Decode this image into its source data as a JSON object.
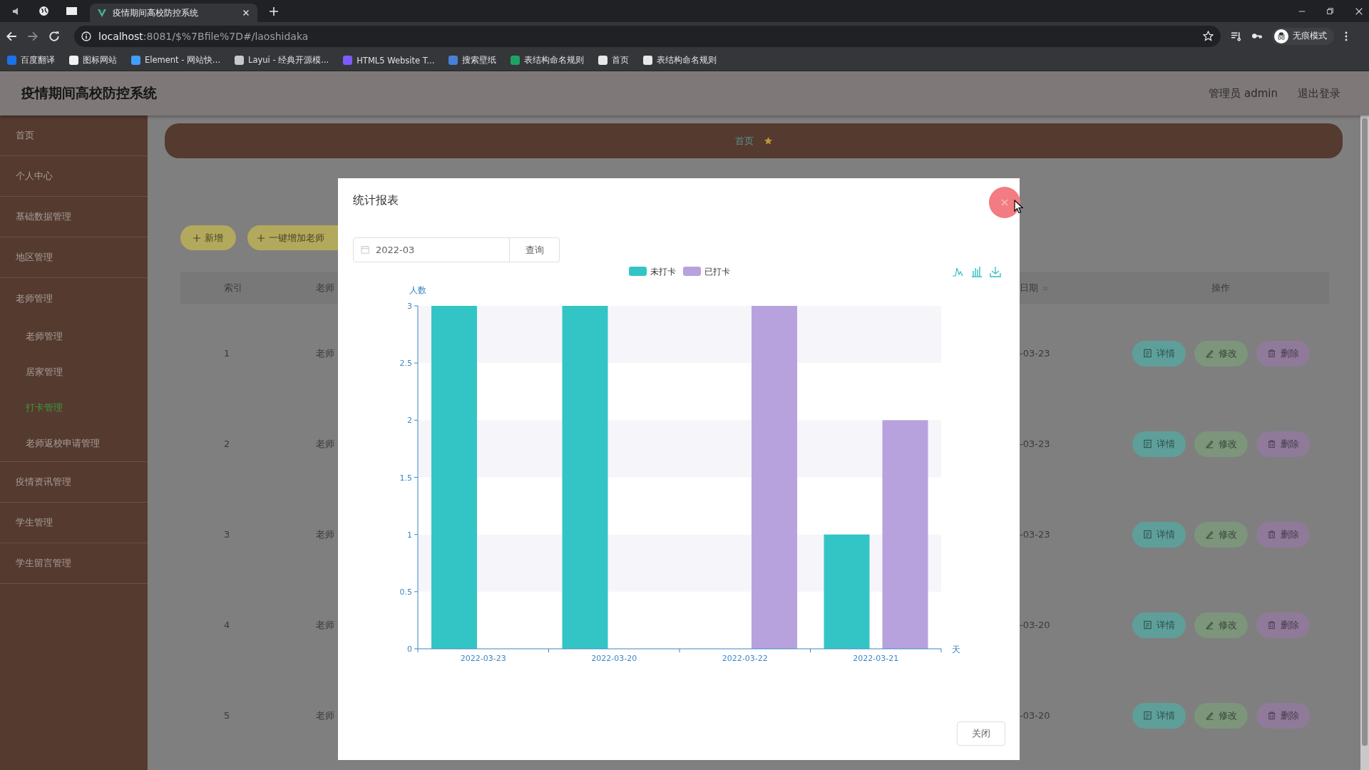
{
  "browser": {
    "tab": {
      "title": "疫情期间高校防控系统"
    },
    "address": {
      "host": "localhost",
      "path": ":8081/$%7Bfile%7D#/laoshidaka"
    },
    "profile": {
      "label": "无痕模式"
    },
    "bookmarks": [
      {
        "label": "百度翻译",
        "color": "#1a73e8"
      },
      {
        "label": "图标网站",
        "color": "#f2f2f2"
      },
      {
        "label": "Element - 网站快...",
        "color": "#409eff"
      },
      {
        "label": "Layui - 经典开源模...",
        "color": "#c8c8c8"
      },
      {
        "label": "HTML5 Website T...",
        "color": "#7c5cff"
      },
      {
        "label": "搜索壁纸",
        "color": "#4a7fd8"
      },
      {
        "label": "表结构命名规则",
        "color": "#1ea362"
      },
      {
        "label": "首页",
        "color": "#e8e8e8"
      },
      {
        "label": "表结构命名规则",
        "color": "#e8e8e8"
      }
    ]
  },
  "header": {
    "title": "疫情期间高校防控系统",
    "user": "管理员 admin",
    "logout": "退出登录"
  },
  "sidebar": {
    "items": [
      {
        "label": "首页",
        "selected": false,
        "expanded": false
      },
      {
        "label": "个人中心",
        "selected": false,
        "expanded": false
      },
      {
        "label": "基础数据管理",
        "selected": false,
        "expanded": false
      },
      {
        "label": "地区管理",
        "selected": false,
        "expanded": false
      },
      {
        "label": "老师管理",
        "selected": false,
        "expanded": true,
        "children": [
          {
            "label": "老师管理",
            "selected": false
          },
          {
            "label": "居家管理",
            "selected": false
          },
          {
            "label": "打卡管理",
            "selected": true
          },
          {
            "label": "老师返校申请管理",
            "selected": false
          }
        ]
      },
      {
        "label": "疫情资讯管理",
        "selected": false,
        "expanded": false
      },
      {
        "label": "学生管理",
        "selected": false,
        "expanded": false
      },
      {
        "label": "学生留言管理",
        "selected": false,
        "expanded": false
      }
    ]
  },
  "breadcrumb": {
    "items": [
      "首页"
    ]
  },
  "toolbar": {
    "buttons": [
      {
        "label": "新增"
      },
      {
        "label": "一键增加老师"
      }
    ]
  },
  "table": {
    "columns": [
      "索引",
      "老师",
      "日期",
      "操作"
    ],
    "rows": [
      {
        "index": "1",
        "teacher": "老师",
        "date": "-03-23",
        "actions": [
          {
            "kind": "detail",
            "label": "详情"
          },
          {
            "kind": "edit",
            "label": "修改"
          },
          {
            "kind": "delete",
            "label": "删除"
          }
        ]
      },
      {
        "index": "2",
        "teacher": "老师",
        "date": "-03-23",
        "actions": [
          {
            "kind": "detail",
            "label": "详情"
          },
          {
            "kind": "edit",
            "label": "修改"
          },
          {
            "kind": "delete",
            "label": "删除"
          }
        ]
      },
      {
        "index": "3",
        "teacher": "老师",
        "date": "-03-23",
        "actions": [
          {
            "kind": "detail",
            "label": "详情"
          },
          {
            "kind": "edit",
            "label": "修改"
          },
          {
            "kind": "delete",
            "label": "删除"
          }
        ]
      },
      {
        "index": "4",
        "teacher": "老师",
        "date": "-03-20",
        "actions": [
          {
            "kind": "detail",
            "label": "详情"
          },
          {
            "kind": "edit",
            "label": "修改"
          },
          {
            "kind": "delete",
            "label": "删除"
          }
        ]
      },
      {
        "index": "5",
        "teacher": "老师",
        "date": "-03-20",
        "actions": [
          {
            "kind": "detail",
            "label": "详情"
          },
          {
            "kind": "edit",
            "label": "修改"
          },
          {
            "kind": "delete",
            "label": "删除"
          }
        ]
      }
    ]
  },
  "dialog": {
    "title": "统计报表",
    "month": {
      "value": "2022-03"
    },
    "query": "查询",
    "close": "关闭",
    "chart_data": {
      "type": "bar",
      "ylabel": "人数",
      "xlabel": "天",
      "categories": [
        "2022-03-23",
        "2022-03-20",
        "2022-03-22",
        "2022-03-21"
      ],
      "series": [
        {
          "name": "未打卡",
          "color": "#33c5c5",
          "values": [
            3,
            3,
            0,
            1
          ]
        },
        {
          "name": "已打卡",
          "color": "#b7a2de",
          "values": [
            0,
            0,
            3,
            2
          ]
        }
      ],
      "legend": "top",
      "ylim": [
        0,
        3
      ],
      "yticks": [
        0,
        0.5,
        1,
        1.5,
        2,
        2.5,
        3
      ]
    }
  }
}
